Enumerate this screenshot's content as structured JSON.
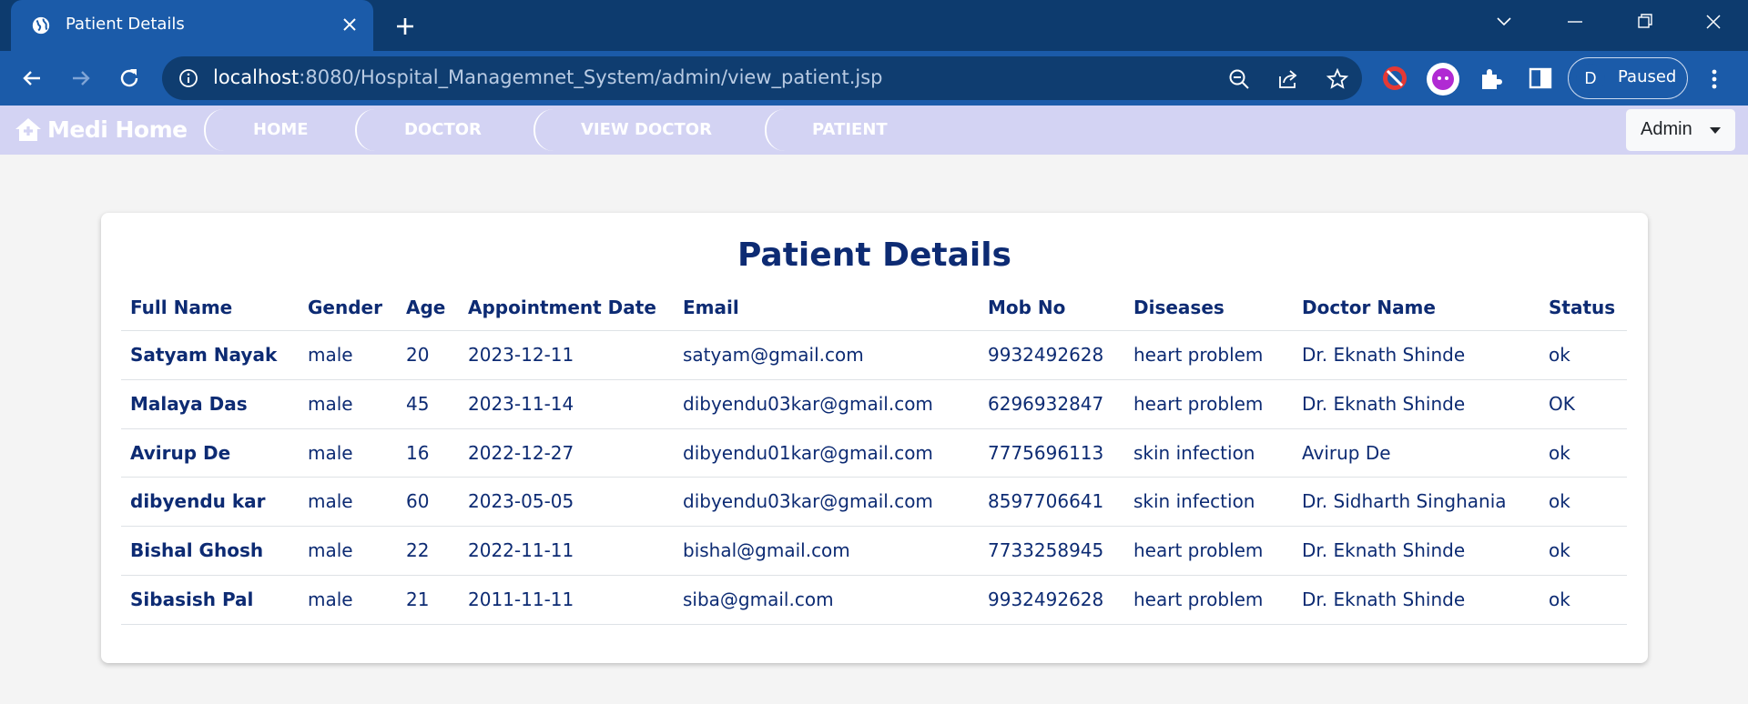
{
  "browser": {
    "tab_title": "Patient Details",
    "url_host": "localhost",
    "url_path": ":8080/Hospital_Managemnet_System/admin/view_patient.jsp",
    "profile_initial": "D",
    "profile_status": "Paused",
    "colors": {
      "tabstrip": "#0d3b6e",
      "toolbar": "#1b5ba9",
      "omnibox": "#0f3d70"
    },
    "icons": [
      "globe-icon",
      "close-icon",
      "plus-icon",
      "chevron-down-icon",
      "minimize-icon",
      "restore-icon",
      "window-close-icon",
      "back-arrow-icon",
      "forward-arrow-icon",
      "reload-icon",
      "info-icon",
      "zoom-out-icon",
      "share-icon",
      "star-icon",
      "extension-icon",
      "puzzle-icon",
      "sidebar-icon",
      "more-vert-icon"
    ]
  },
  "navbar": {
    "brand": "Medi Home",
    "items": [
      "HOME",
      "DOCTOR",
      "VIEW DOCTOR",
      "PATIENT"
    ],
    "admin_label": "Admin",
    "colors": {
      "background": "#d3d3f3",
      "text": "#ffffff"
    }
  },
  "card": {
    "title": "Patient Details",
    "columns": [
      "Full Name",
      "Gender",
      "Age",
      "Appointment Date",
      "Email",
      "Mob No",
      "Diseases",
      "Doctor Name",
      "Status"
    ],
    "rows": [
      [
        "Satyam Nayak",
        "male",
        "20",
        "2023-12-11",
        "satyam@gmail.com",
        "9932492628",
        "heart problem",
        "Dr. Eknath Shinde",
        "ok"
      ],
      [
        "Malaya Das",
        "male",
        "45",
        "2023-11-14",
        "dibyendu03kar@gmail.com",
        "6296932847",
        "heart problem",
        "Dr. Eknath Shinde",
        "OK"
      ],
      [
        "Avirup De",
        "male",
        "16",
        "2022-12-27",
        "dibyendu01kar@gmail.com",
        "7775696113",
        "skin infection",
        "Avirup De",
        "ok"
      ],
      [
        "dibyendu kar",
        "male",
        "60",
        "2023-05-05",
        "dibyendu03kar@gmail.com",
        "8597706641",
        "skin infection",
        "Dr. Sidharth Singhania",
        "ok"
      ],
      [
        "Bishal Ghosh",
        "male",
        "22",
        "2022-11-11",
        "bishal@gmail.com",
        "7733258945",
        "heart problem",
        "Dr. Eknath Shinde",
        "ok"
      ],
      [
        "Sibasish Pal",
        "male",
        "21",
        "2011-11-11",
        "siba@gmail.com",
        "9932492628",
        "heart problem",
        "Dr. Eknath Shinde",
        "ok"
      ]
    ],
    "colors": {
      "text": "#0d2b73",
      "page_bg": "#f4f4f4"
    }
  }
}
